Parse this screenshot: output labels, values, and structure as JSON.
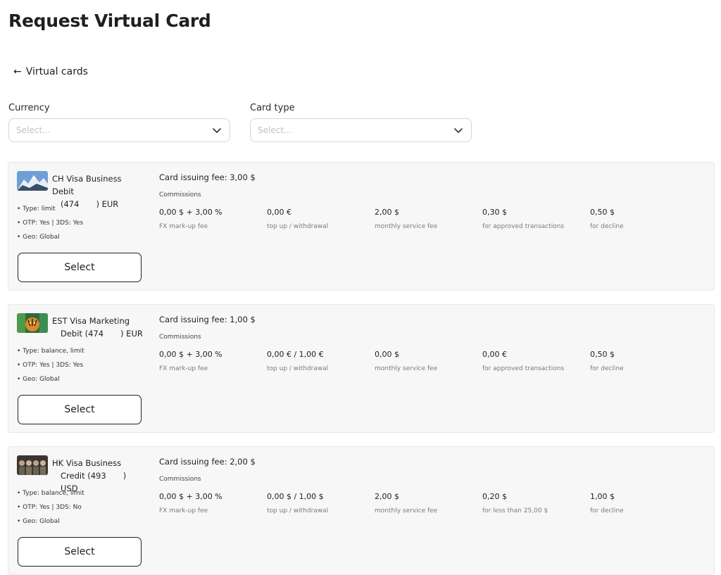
{
  "page": {
    "title": "Request Virtual Card"
  },
  "nav": {
    "back_arrow": "←",
    "back_label": "Virtual cards"
  },
  "filters": {
    "currency": {
      "label": "Currency",
      "placeholder": "Select..."
    },
    "card_type": {
      "label": "Card type",
      "placeholder": "Select..."
    }
  },
  "cards": [
    {
      "name_line1": "CH Visa Business Debit",
      "name_pre": "(474",
      "name_post": ") EUR",
      "image_icon": "mountain-card-image",
      "features": [
        "• Type: limit",
        "• OTP: Yes | 3DS: Yes",
        "• Geo: Global"
      ],
      "select_label": "Select",
      "issuing_fee": "Card issuing fee: 3,00 $",
      "commissions_label": "Commissions",
      "columns": [
        {
          "value": "0,00 $ + 3,00 %",
          "desc": "FX mark-up fee"
        },
        {
          "value": "0,00 €",
          "desc": "top up / withdrawal"
        },
        {
          "value": "2,00 $",
          "desc": "monthly service fee"
        },
        {
          "value": "0,30 $",
          "desc": "for approved transactions"
        },
        {
          "value": "0,50 $",
          "desc": "for decline"
        }
      ]
    },
    {
      "name_line1": "EST Visa Marketing",
      "name_pre": "Debit (474",
      "name_post": ") EUR",
      "image_icon": "tiger-card-image",
      "features": [
        "• Type: balance, limit",
        "• OTP: Yes | 3DS: Yes",
        "• Geo: Global"
      ],
      "select_label": "Select",
      "issuing_fee": "Card issuing fee: 1,00 $",
      "commissions_label": "Commissions",
      "columns": [
        {
          "value": "0,00 $ + 3,00 %",
          "desc": "FX mark-up fee"
        },
        {
          "value": "0,00 € / 1,00 €",
          "desc": "top up / withdrawal"
        },
        {
          "value": "0,00 $",
          "desc": "monthly service fee"
        },
        {
          "value": "0,00 €",
          "desc": "for approved transactions"
        },
        {
          "value": "0,50 $",
          "desc": "for decline"
        }
      ]
    },
    {
      "name_line1": "HK Visa Business",
      "name_pre": "Credit (493",
      "name_post": ") USD",
      "image_icon": "figures-card-image",
      "features": [
        "• Type: balance, limit",
        "• OTP: Yes | 3DS: No",
        "• Geo: Global"
      ],
      "select_label": "Select",
      "issuing_fee": "Card issuing fee: 2,00 $",
      "commissions_label": "Commissions",
      "columns": [
        {
          "value": "0,00 $ + 3,00 %",
          "desc": "FX mark-up fee"
        },
        {
          "value": "0,00 $ / 1,00 $",
          "desc": "top up / withdrawal"
        },
        {
          "value": "2,00 $",
          "desc": "monthly service fee"
        },
        {
          "value": "0,20 $",
          "desc": "for less than 25,00 $"
        },
        {
          "value": "1,00 $",
          "desc": "for decline"
        }
      ]
    }
  ],
  "colors": {
    "panel_bg": "#f7f7f7",
    "border": "#d6d6d6",
    "text": "#1f1f1f",
    "muted": "#7a7a7a"
  }
}
